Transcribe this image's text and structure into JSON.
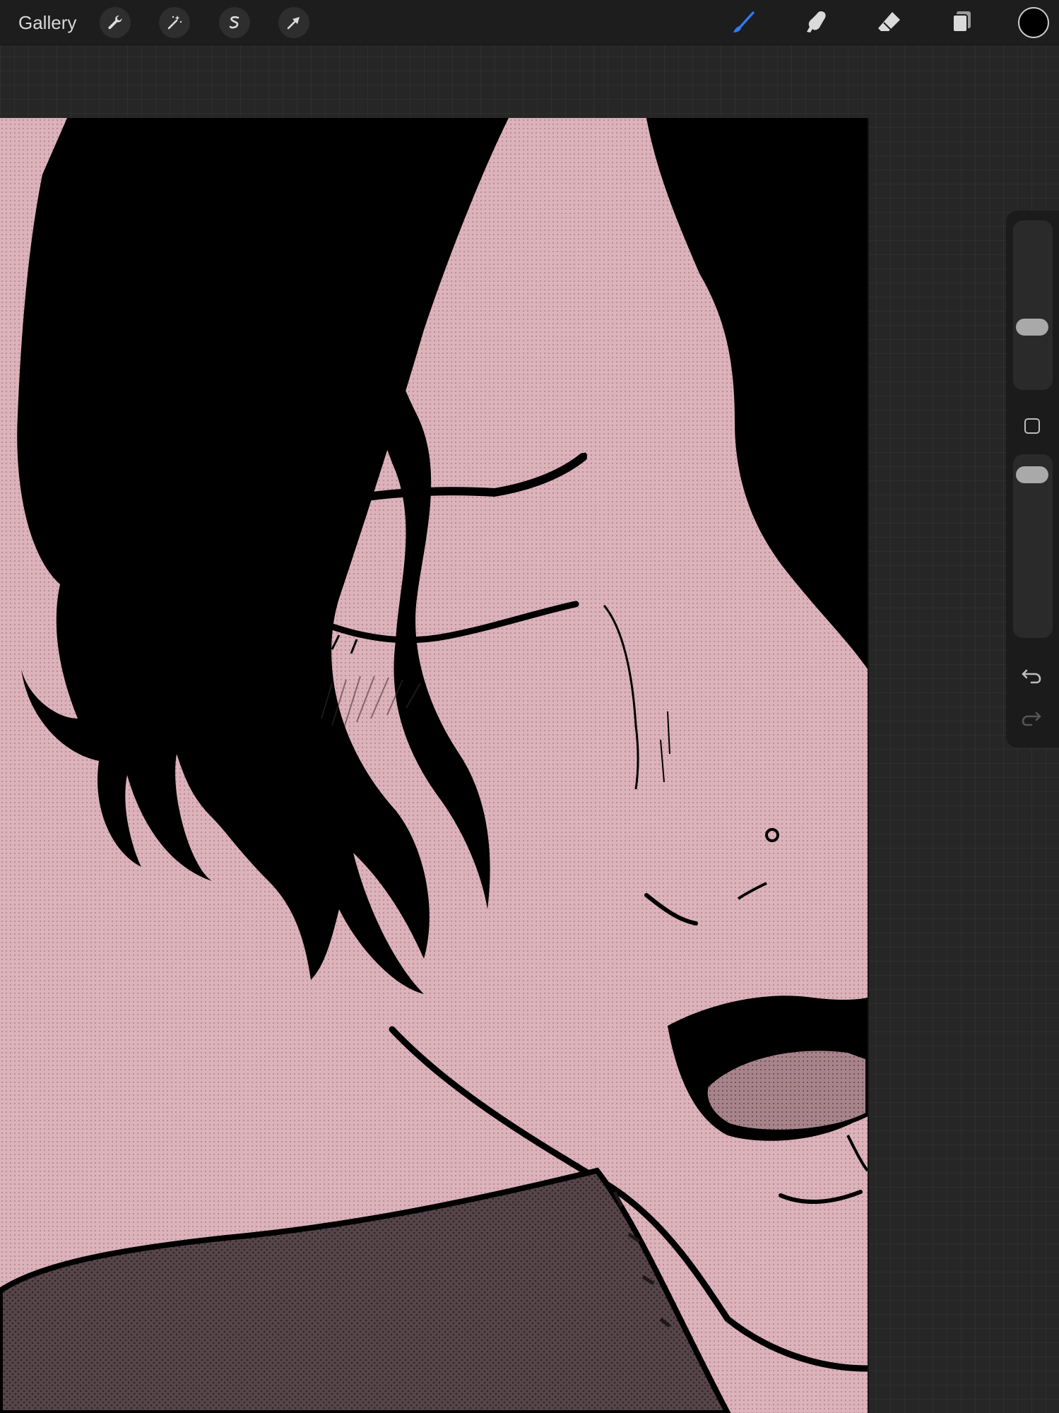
{
  "toolbar": {
    "gallery_label": "Gallery",
    "left_tools": [
      "wrench-icon",
      "magic-wand-icon",
      "selection-icon",
      "transform-arrow-icon"
    ],
    "right_tools": [
      "brush-icon",
      "smudge-icon",
      "eraser-icon",
      "layers-icon"
    ],
    "active_tool": "brush",
    "active_tool_color": "#2f7bf5",
    "current_color": "#000000"
  },
  "sidebar": {
    "brush_size_level": 0.35,
    "opacity_level": 0.95,
    "modify_button": "square-icon",
    "undo": "undo-icon",
    "redo": "redo-icon",
    "redo_enabled": false
  },
  "canvas": {
    "background_color": "#dcb2bb",
    "ink_color": "#000000",
    "shirt_color": "#564549"
  }
}
